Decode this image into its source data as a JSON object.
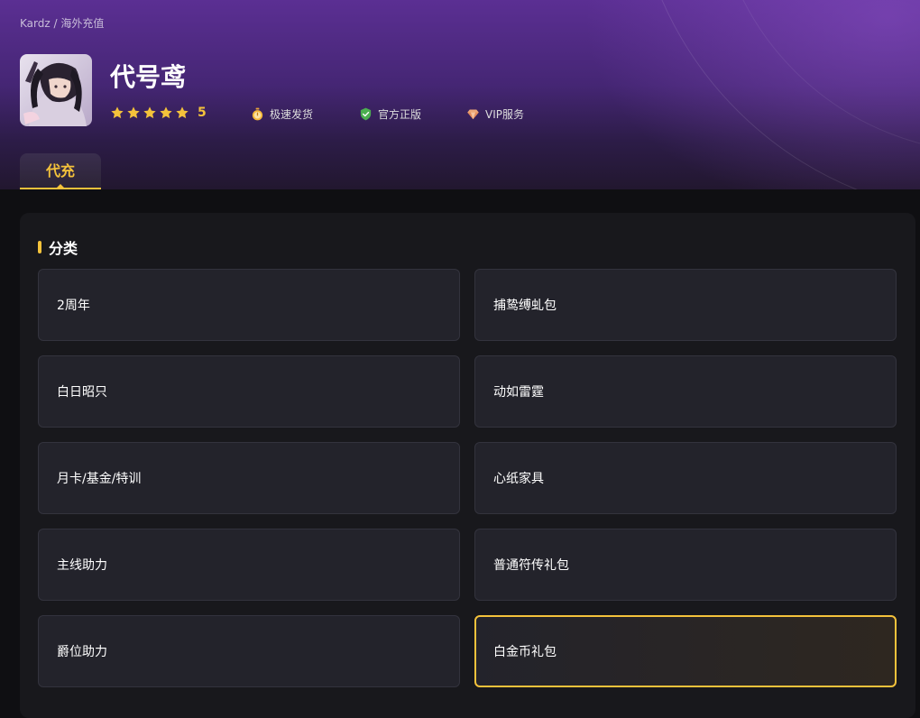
{
  "breadcrumb": "Kardz / 海外充值",
  "game": {
    "title": "代号鸢",
    "rating": "5",
    "stars": 5
  },
  "features": [
    {
      "label": "极速发货",
      "icon": "stopwatch-icon"
    },
    {
      "label": "官方正版",
      "icon": "shield-check-icon"
    },
    {
      "label": "VIP服务",
      "icon": "diamond-icon"
    }
  ],
  "tab": {
    "label": "代充"
  },
  "section": {
    "title": "分类"
  },
  "categories": [
    "2周年",
    "捕鸷缚虬包",
    "白日昭只",
    "动如雷霆",
    "月卡/基金/特训",
    "心纸家具",
    "主线助力",
    "普通符传礼包",
    "爵位助力",
    "白金币礼包"
  ],
  "selected_category": "白金币礼包",
  "colors": {
    "accent": "#f4c23b",
    "hero_top": "#5b2f93",
    "panel": "#18181c",
    "card": "#23232b"
  }
}
